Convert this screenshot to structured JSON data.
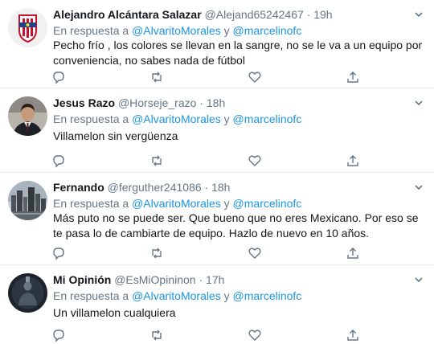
{
  "colors": {
    "link": "#1b95e0",
    "muted": "#657786",
    "text": "#14171a",
    "divider": "#e6ecf0"
  },
  "tweets": [
    {
      "name": "Alejandro Alcántara Salazar",
      "handle": "@Alejand65242467",
      "dot": "·",
      "time": "19h",
      "reply_prefix": "En respuesta a",
      "reply_user1": "@AlvaritoMorales",
      "reply_join": "y",
      "reply_user2": "@marcelinofc",
      "text": "Pecho frío , los colores se llevan en la sangre, no se le va a un equipo por conveniencia, no sabes nada de fútbol",
      "avatar_icon": "chivas-crest-avatar"
    },
    {
      "name": "Jesus Razo",
      "handle": "@Horseje_razo",
      "dot": "·",
      "time": "18h",
      "reply_prefix": "En respuesta a",
      "reply_user1": "@AlvaritoMorales",
      "reply_join": "y",
      "reply_user2": "@marcelinofc",
      "text": "Villamelon sin vergüenza",
      "avatar_icon": "man-in-suit-avatar"
    },
    {
      "name": "Fernando",
      "handle": "@ferguther241086",
      "dot": "·",
      "time": "18h",
      "reply_prefix": "En respuesta a",
      "reply_user1": "@AlvaritoMorales",
      "reply_join": "y",
      "reply_user2": "@marcelinofc",
      "text": "Más puto no se puede ser. Que bueno que no eres Mexicano. Por eso se te pasa lo de cambiarte de equipo. Hazlo de nuevo en 10 años.",
      "avatar_icon": "city-skyline-avatar"
    },
    {
      "name": "Mi Opinión",
      "handle": "@EsMiOpininon",
      "dot": "·",
      "time": "17h",
      "reply_prefix": "En respuesta a",
      "reply_user1": "@AlvaritoMorales",
      "reply_join": "y",
      "reply_user2": "@marcelinofc",
      "text": "Un villamelon cualquiera",
      "avatar_icon": "dark-figure-avatar"
    }
  ],
  "action_icons": [
    "reply-icon",
    "retweet-icon",
    "like-icon",
    "share-icon"
  ]
}
